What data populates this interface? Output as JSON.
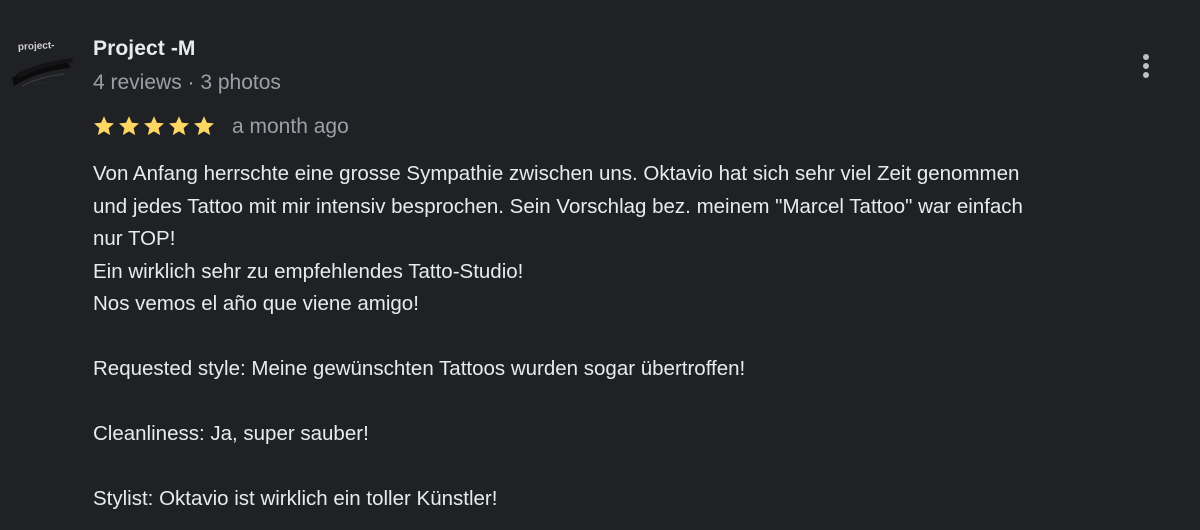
{
  "review": {
    "author": {
      "name": "Project -M",
      "meta": "4 reviews · 3 photos",
      "avatar_text": "project-"
    },
    "rating": 5,
    "rating_max": 5,
    "star_color": "#fdd663",
    "time_ago": "a month ago",
    "more_icon": "vertical-dots-icon",
    "lines": [
      "Von Anfang herrschte eine grosse Sympathie zwischen uns. Oktavio hat sich sehr viel Zeit genommen",
      "und jedes Tattoo mit mir intensiv besprochen. Sein Vorschlag bez. meinem \"Marcel Tattoo\" war einfach",
      "nur TOP!",
      "Ein wirklich sehr zu empfehlendes Tatto-Studio!",
      "Nos vemos el año que viene amigo!",
      "",
      "Requested style: Meine gewünschten Tattoos wurden sogar übertroffen!",
      "",
      "Cleanliness: Ja, super sauber!",
      "",
      "Stylist: Oktavio ist wirklich ein toller Künstler!"
    ]
  }
}
